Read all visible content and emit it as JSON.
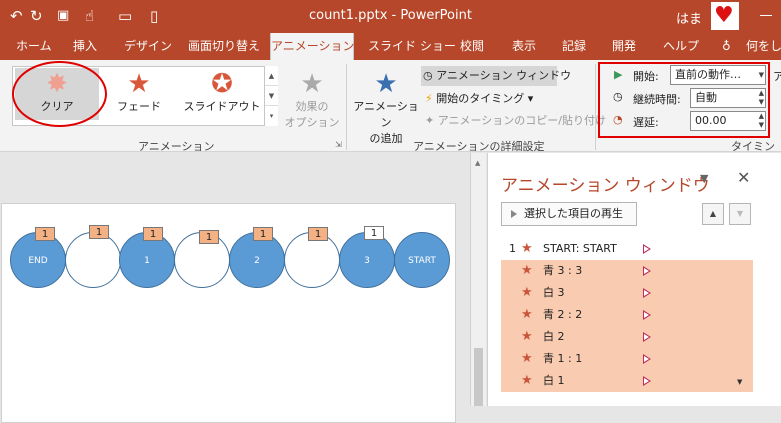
{
  "window": {
    "title": "count1.pptx  -  PowerPoint",
    "user": "はま",
    "qat_icons": [
      "undo-icon",
      "redo-icon",
      "start-slideshow-icon",
      "touch-mode-icon",
      "open-folder-icon",
      "new-file-icon"
    ]
  },
  "tabs": [
    {
      "label": "ホーム"
    },
    {
      "label": "挿入"
    },
    {
      "label": "デザイン"
    },
    {
      "label": "画面切り替え"
    },
    {
      "label": "アニメーション",
      "active": true
    },
    {
      "label": "スライド ショー"
    },
    {
      "label": "校閲"
    },
    {
      "label": "表示"
    },
    {
      "label": "記録"
    },
    {
      "label": "開発"
    },
    {
      "label": "ヘルプ"
    },
    {
      "label": "何をし"
    }
  ],
  "ribbon": {
    "animation_gallery": [
      {
        "label": "クリア",
        "icon": "burst-icon",
        "selected": true
      },
      {
        "label": "フェード",
        "icon": "star-icon"
      },
      {
        "label": "スライドアウト",
        "icon": "star-down-icon"
      }
    ],
    "effect_options": {
      "line1": "効果の",
      "line2": "オプション"
    },
    "group_animation": "アニメーション",
    "add_animation": {
      "line1": "アニメーション",
      "line2": "の追加"
    },
    "animation_pane": "アニメーション ウィンドウ",
    "trigger": "開始のタイミング",
    "painter": "アニメーションのコピー/貼り付け",
    "group_advanced": "アニメーションの詳細設定",
    "timing": {
      "start_label": "開始:",
      "start_value": "直前の動作…",
      "duration_label": "継続時間:",
      "duration_value": "自動",
      "delay_label": "遅延:",
      "delay_value": "00.00",
      "group_label": "タイミング",
      "cut_label": "ア"
    }
  },
  "slide": {
    "shapes": [
      {
        "text": "END",
        "color": "blue",
        "tag": "1"
      },
      {
        "text": "",
        "color": "white",
        "tag": "1"
      },
      {
        "text": "1",
        "color": "blue",
        "tag": "1"
      },
      {
        "text": "",
        "color": "white",
        "tag": "1"
      },
      {
        "text": "2",
        "color": "blue",
        "tag": "1"
      },
      {
        "text": "",
        "color": "white",
        "tag": "1"
      },
      {
        "text": "3",
        "color": "blue",
        "tag": "1"
      },
      {
        "text": "START",
        "color": "blue",
        "tag": ""
      }
    ]
  },
  "pane": {
    "title": "アニメーション ウィンドウ",
    "play_button": "選択した項目の再生",
    "items": [
      {
        "num": "1",
        "name": "START: START",
        "selected": false
      },
      {
        "num": "",
        "name": "青 3 : 3",
        "selected": true
      },
      {
        "num": "",
        "name": "白 3",
        "selected": true
      },
      {
        "num": "",
        "name": "青 2 : 2",
        "selected": true
      },
      {
        "num": "",
        "name": "白 2",
        "selected": true
      },
      {
        "num": "",
        "name": "青 1 : 1",
        "selected": true
      },
      {
        "num": "",
        "name": "白 1",
        "selected": true
      }
    ]
  }
}
